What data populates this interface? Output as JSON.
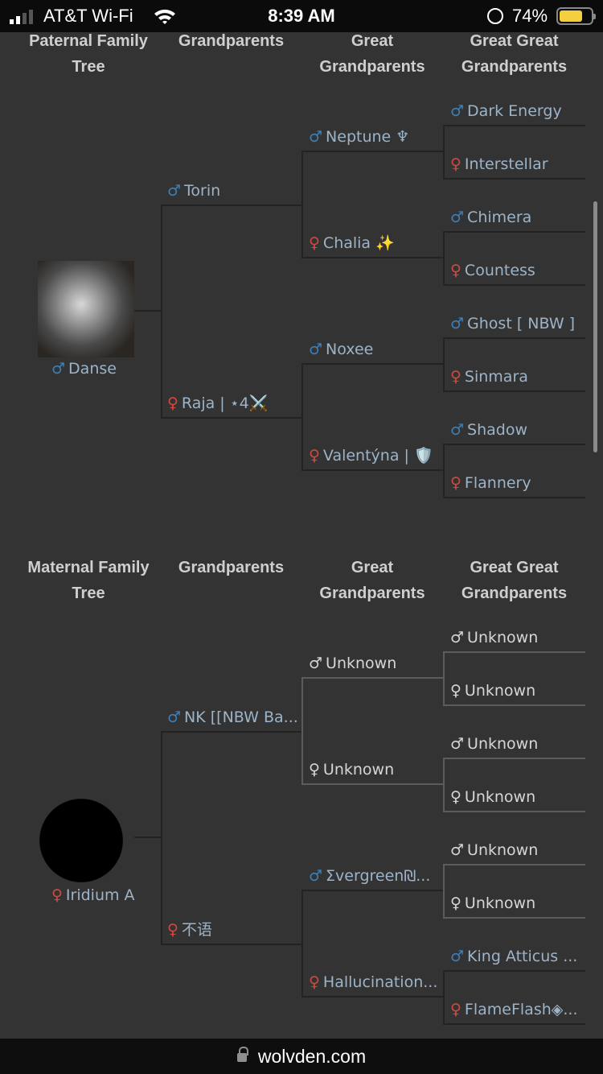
{
  "status_bar": {
    "carrier": "AT&T Wi-Fi",
    "time": "8:39 AM",
    "battery": "74%",
    "battery_level": 0.74
  },
  "colors": {
    "male": "#3d7fb6",
    "female": "#d24a3f",
    "name": "#9db3c8",
    "unknown": "#d6d6d6"
  },
  "trees": [
    {
      "headers": {
        "col1": "Paternal Family Tree",
        "col2": "Grandparents",
        "col3": "Great Grandparents",
        "col4": "Great Great Grandparents"
      },
      "parent": {
        "sex": "male",
        "name": "Danse",
        "picture": "grey-wolf-portrait"
      },
      "grandparents": [
        {
          "sex": "male",
          "name": "Torin"
        },
        {
          "sex": "female",
          "name": "Raja | ⋆4⚔️"
        }
      ],
      "great_grandparents": [
        {
          "sex": "male",
          "name": "Neptune ♆"
        },
        {
          "sex": "female",
          "name": "Chalia ✨"
        },
        {
          "sex": "male",
          "name": "Noxee"
        },
        {
          "sex": "female",
          "name": "Valentýna | 🛡️"
        }
      ],
      "great_great_grandparents": [
        {
          "sex": "male",
          "name": "Dark Energy"
        },
        {
          "sex": "female",
          "name": "Interstellar"
        },
        {
          "sex": "male",
          "name": "Chimera"
        },
        {
          "sex": "female",
          "name": "Countess"
        },
        {
          "sex": "male",
          "name": "Ghost [ NBW ]"
        },
        {
          "sex": "female",
          "name": "Sinmara"
        },
        {
          "sex": "male",
          "name": "Shadow"
        },
        {
          "sex": "female",
          "name": "Flannery"
        }
      ]
    },
    {
      "headers": {
        "col1": "Maternal Family Tree",
        "col2": "Grandparents",
        "col3": "Great Grandparents",
        "col4": "Great Great Grandparents"
      },
      "parent": {
        "sex": "female",
        "name": "Iridium A",
        "picture": "black-wolf-silhouette"
      },
      "grandparents": [
        {
          "sex": "male",
          "name": "NK [[NBW Ba..."
        },
        {
          "sex": "female",
          "name": "不语"
        }
      ],
      "great_grandparents": [
        {
          "sex": "male",
          "name": "Unknown",
          "unknown": true
        },
        {
          "sex": "female",
          "name": "Unknown",
          "unknown": true
        },
        {
          "sex": "male",
          "name": "Σvergreen₪..."
        },
        {
          "sex": "female",
          "name": "Hallucination..."
        }
      ],
      "great_great_grandparents": [
        {
          "sex": "male",
          "name": "Unknown",
          "unknown": true
        },
        {
          "sex": "female",
          "name": "Unknown",
          "unknown": true
        },
        {
          "sex": "male",
          "name": "Unknown",
          "unknown": true
        },
        {
          "sex": "female",
          "name": "Unknown",
          "unknown": true
        },
        {
          "sex": "male",
          "name": "Unknown",
          "unknown": true
        },
        {
          "sex": "female",
          "name": "Unknown",
          "unknown": true
        },
        {
          "sex": "male",
          "name": "King Atticus ..."
        },
        {
          "sex": "female",
          "name": "FlameFlash◈..."
        }
      ]
    }
  ],
  "browser": {
    "url": "wolvden.com"
  }
}
